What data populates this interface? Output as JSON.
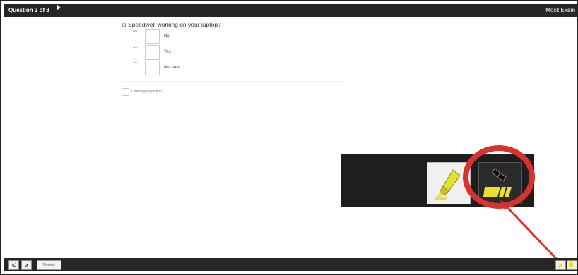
{
  "header": {
    "question_counter": "Question 3 of 8",
    "exam_title": "Mock Exam"
  },
  "question": {
    "text": "Is Speedwell working on your laptop?",
    "options": [
      {
        "tag": "abc",
        "label": "No"
      },
      {
        "tag": "abc",
        "label": "Yes"
      },
      {
        "tag": "abc",
        "label": "Not sure"
      }
    ]
  },
  "challenge_label": "Challenge question",
  "toolbar": {
    "review_label": "Review"
  },
  "icons": {
    "highlighter": "highlighter-icon",
    "eraser": "eraser-icon",
    "prev": "chevron-left-icon",
    "next": "chevron-right-icon"
  },
  "colors": {
    "highlight_yellow": "#e8e02a",
    "callout_red": "#d9322e",
    "bar": "#262626"
  },
  "nav": {
    "prev": "<",
    "next": ">"
  }
}
